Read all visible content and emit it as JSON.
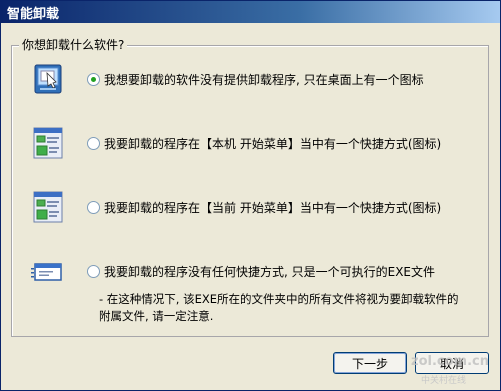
{
  "window": {
    "title": "智能卸载"
  },
  "group": {
    "title": "你想卸载什么软件?"
  },
  "options": [
    {
      "label": "我想要卸载的软件没有提供卸载程序, 只在桌面上有一个图标",
      "selected": true,
      "icon": "desktop-shortcut-icon"
    },
    {
      "label": "我要卸载的程序在【本机 开始菜单】当中有一个快捷方式(图标)",
      "selected": false,
      "icon": "start-menu-icon"
    },
    {
      "label": "我要卸载的程序在【当前 开始菜单】当中有一个快捷方式(图标)",
      "selected": false,
      "icon": "start-menu-icon"
    },
    {
      "label": "我要卸载的程序没有任何快捷方式, 只是一个可执行的EXE文件",
      "selected": false,
      "icon": "exe-file-icon"
    }
  ],
  "note": "- 在这种情况下, 该EXE所在的文件夹中的所有文件将视为要卸载软件的附属文件, 请一定注意.",
  "buttons": {
    "next": "下一步",
    "cancel": "取消"
  },
  "watermark": {
    "main": "zol.com.cn",
    "sub": "中关村在线"
  }
}
